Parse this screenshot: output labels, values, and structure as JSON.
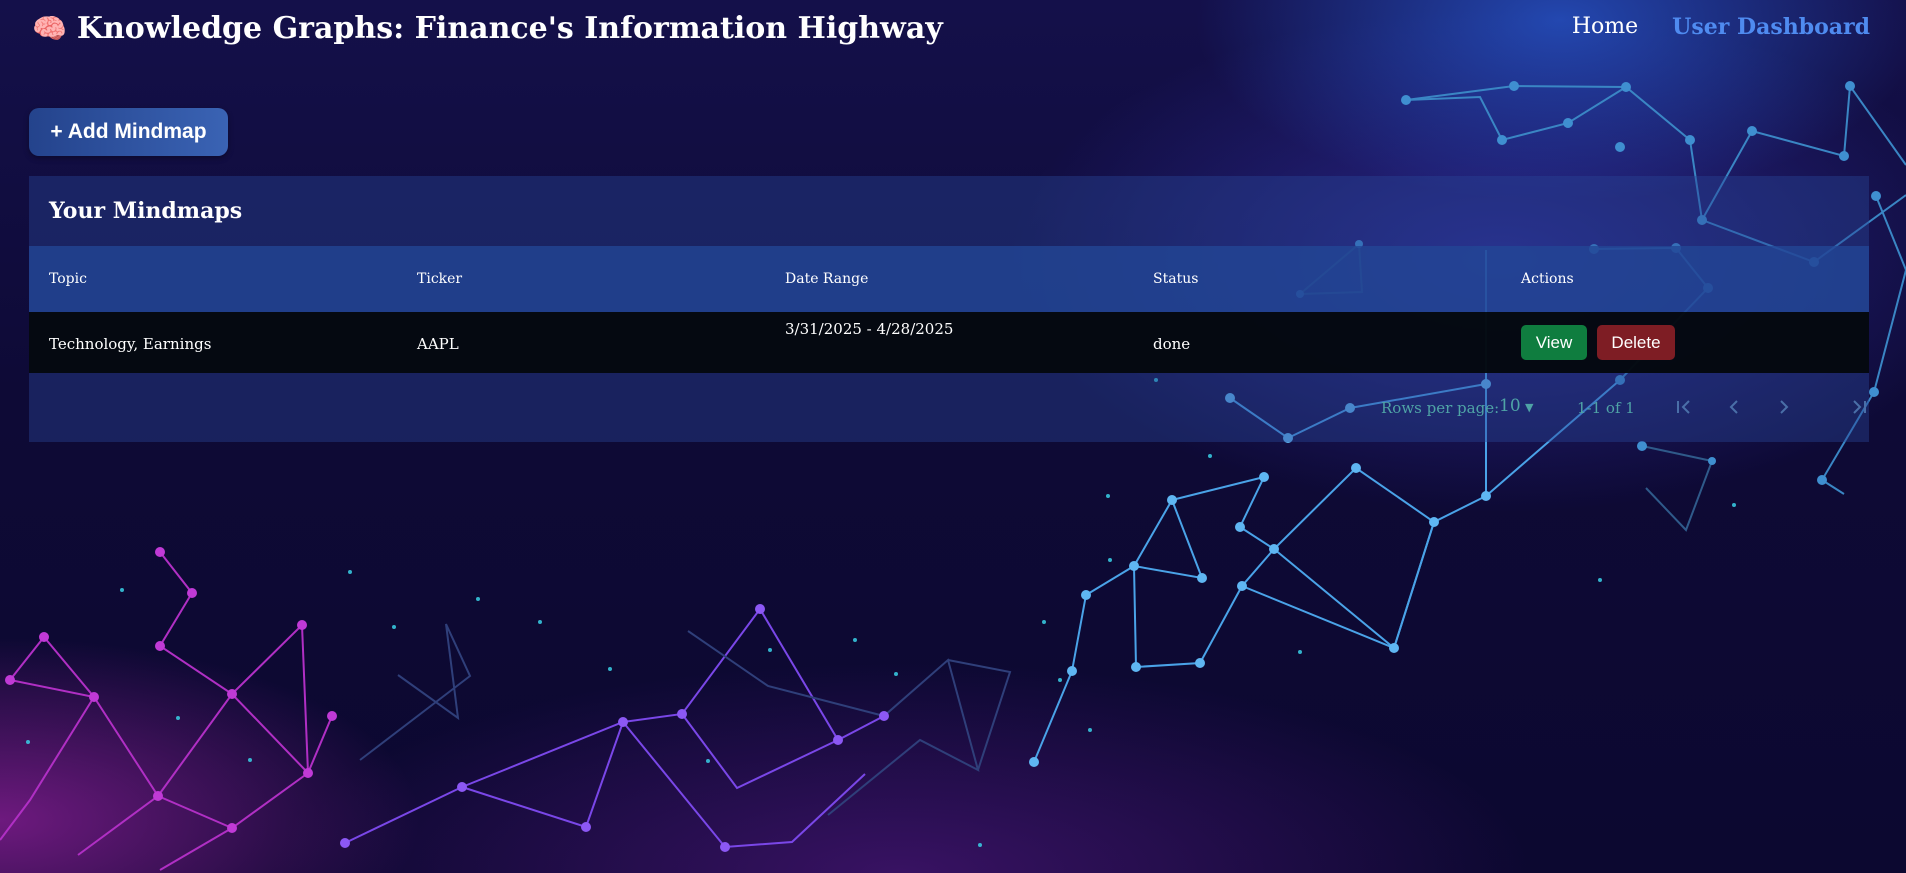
{
  "app": {
    "title": "Knowledge Graphs: Finance's Information Highway",
    "brand_icon": "brain-icon"
  },
  "nav": {
    "home": "Home",
    "dashboard": "User Dashboard"
  },
  "actions": {
    "add_mindmap": "+ Add Mindmap"
  },
  "table": {
    "title": "Your Mindmaps",
    "columns": [
      "Topic",
      "Ticker",
      "Date Range",
      "Status",
      "Actions"
    ],
    "rows": [
      {
        "topic": "Technology, Earnings",
        "ticker": "AAPL",
        "date_range": "3/31/2025 - 4/28/2025",
        "status": "done",
        "view_label": "View",
        "delete_label": "Delete"
      }
    ],
    "pagination": {
      "rows_per_page_label": "Rows per page:",
      "rows_per_page": "10",
      "range": "1-1 of 1"
    }
  },
  "colors": {
    "accent_link": "#4f8bf0",
    "view_button": "#0f7d3f",
    "delete_button": "#7e1d24",
    "header_row": "#22468f"
  }
}
